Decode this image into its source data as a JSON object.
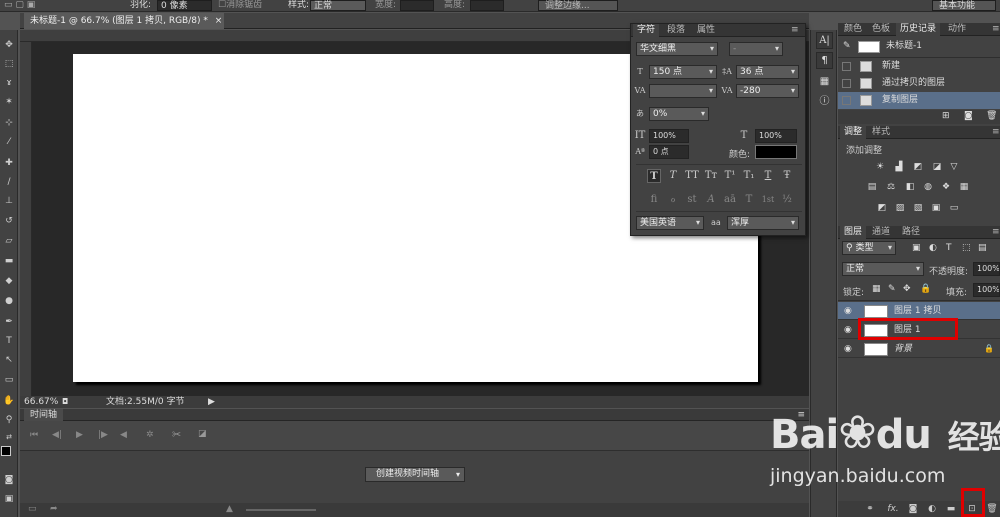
{
  "options_bar": {
    "feather_label": "羽化:",
    "feather_value": "0 像素",
    "antialias_label": "消除锯齿",
    "style_label": "样式:",
    "style_value": "正常",
    "width_label": "宽度:",
    "height_label": "高度:",
    "refine_edge": "调整边缘...",
    "workspace": "基本功能"
  },
  "document": {
    "tab_title": "未标题-1 @ 66.7% (图层 1 拷贝, RGB/8) *",
    "zoom": "66.67%",
    "doc_size": "文档:2.55M/0 字节"
  },
  "timeline": {
    "title": "时间轴",
    "create_button": "创建视频时间轴"
  },
  "character_panel": {
    "tabs": [
      "字符",
      "段落",
      "属性"
    ],
    "font_family": "华文细黑",
    "font_style": "-",
    "font_size": "150 点",
    "leading": "36 点",
    "kerning": "",
    "tracking": "-280",
    "tsume": "0%",
    "vertical_scale": "100%",
    "horizontal_scale": "100%",
    "baseline_shift": "0 点",
    "color_label": "颜色:",
    "color": "#000000",
    "language": "美国英语",
    "aa_label": "aa",
    "antialias": "浑厚",
    "style_glyphs": [
      "T",
      "T",
      "TT",
      "Tт",
      "T¹",
      "T₁",
      "T",
      "Ŧ"
    ],
    "opentype_glyphs": [
      "fi",
      "ℴ",
      "st",
      "A",
      "aā",
      "T",
      "1st",
      "½"
    ]
  },
  "history_panel": {
    "tabs": [
      "颜色",
      "色板",
      "历史记录",
      "动作"
    ],
    "snapshot": "未标题-1",
    "items": [
      "新建",
      "通过拷贝的图层",
      "复制图层"
    ]
  },
  "adjustments_panel": {
    "tabs": [
      "调整",
      "样式"
    ],
    "title": "添加调整"
  },
  "layers_panel": {
    "tabs": [
      "图层",
      "通道",
      "路径"
    ],
    "filter_kind": "类型",
    "blend_mode": "正常",
    "opacity_label": "不透明度:",
    "opacity": "100%",
    "lock_label": "锁定:",
    "fill_label": "填充:",
    "fill": "100%",
    "layers": [
      "图层 1 拷贝",
      "图层 1",
      "背景"
    ]
  },
  "watermark": {
    "brand_en": "Bai",
    "brand_du": "du",
    "brand_cn": "经验",
    "url": "jingyan.baidu.com"
  },
  "colors": {
    "highlight": "#e00000",
    "selected_row": "#5a6f8a",
    "canvas": "#ffffff"
  }
}
